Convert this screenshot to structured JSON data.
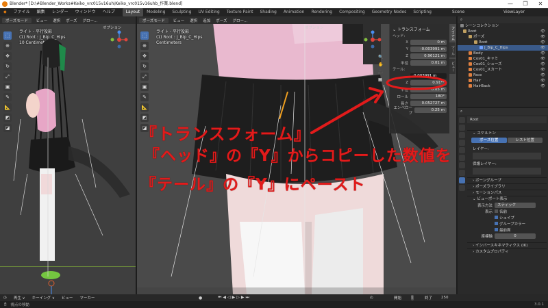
{
  "window": {
    "title": "Blender* [D:\\#Blender_Works#Keiko_vrc015v16uh\\Keiko_vrc015v16uhb_作業.blend]",
    "min": "—",
    "max": "❐",
    "close": "✕"
  },
  "menu": [
    "ファイル",
    "編集",
    "レンダー",
    "ウィンドウ",
    "ヘルプ"
  ],
  "tabs": [
    "Layout",
    "Modeling",
    "Sculpting",
    "UV Editing",
    "Texture Paint",
    "Shading",
    "Animation",
    "Rendering",
    "Compositing",
    "Geometry Nodes",
    "Scripting"
  ],
  "scene": {
    "label": "Scene",
    "viewlayer": "ViewLayer"
  },
  "left_view": {
    "mode": "ポーズモード",
    "menus": [
      "ビュー",
      "選択",
      "ポーズ"
    ],
    "orientation": "グロー...",
    "options": "オプション",
    "info": [
      "ライト - 平行投影",
      "(1) Root : J_Bip_C_Hips",
      "10 Centimeters"
    ]
  },
  "mid_view": {
    "mode": "ポーズモード",
    "menus": [
      "ビュー",
      "選択",
      "追加",
      "ポーズ"
    ],
    "orientation": "グロー...",
    "options": "オプション",
    "info": [
      "ライト - 平行投影",
      "(1) Root : J_Bip_C_Hips",
      "Centimeters"
    ]
  },
  "npanel": {
    "section": "トランスフォーム",
    "head_label": "ヘッド:",
    "head": [
      {
        "label": "X",
        "value": "0 m"
      },
      {
        "label": "Y",
        "value": "-0.003991 m"
      },
      {
        "label": "Z",
        "value": "0.96121 m"
      }
    ],
    "radius1": {
      "label": "半径",
      "value": "0.01 m"
    },
    "tail_label": "テール:",
    "tail_input": "-0.003991 m",
    "tail": [
      {
        "label": "Z",
        "value": "0.91**"
      }
    ],
    "more": [
      {
        "label": "半径",
        "value": "0.05 m"
      },
      {
        "label": "ロール",
        "value": "180°"
      },
      {
        "label": "長さ",
        "value": "0.052727 m"
      },
      {
        "label": "エンベロープ",
        "value": "0.25 m"
      }
    ],
    "vtabs": [
      "アイテム",
      "ツール",
      "ビュー"
    ]
  },
  "outliner": {
    "title": "シーンコレクション",
    "rows": [
      {
        "label": "Root",
        "indent": 0,
        "color": "#c0a060"
      },
      {
        "label": "ポーズ",
        "indent": 1,
        "color": "#c0a060"
      },
      {
        "label": "Root",
        "indent": 2,
        "color": "#c0a060"
      },
      {
        "label": "J_Bip_C_Hips",
        "indent": 3,
        "color": "#6fa0ff",
        "sel": true
      },
      {
        "label": "Body",
        "indent": 1,
        "color": "#e08040"
      },
      {
        "label": "Cos01_キャミ",
        "indent": 1,
        "color": "#e08040"
      },
      {
        "label": "Cos01_シューズ",
        "indent": 1,
        "color": "#e08040"
      },
      {
        "label": "Cos01_スカート",
        "indent": 1,
        "color": "#e08040"
      },
      {
        "label": "Face",
        "indent": 1,
        "color": "#e08040"
      },
      {
        "label": "Hair",
        "indent": 1,
        "color": "#e08040"
      },
      {
        "label": "HairBack",
        "indent": 1,
        "color": "#e08040"
      }
    ]
  },
  "properties": {
    "object": "Root",
    "skeleton": "スケルトン",
    "pose_position": "ポーズ位置",
    "rest_position": "レスト位置",
    "layers": "レイヤー:",
    "protected_layers": "保護レイヤー:",
    "sections": [
      "ボーングループ",
      "ポーズライブラリ",
      "モーションパス",
      "ビューポート表示"
    ],
    "display_as_label": "表示方法",
    "display_as_value": "スティック",
    "show_label": "表示",
    "show_items": [
      "名前",
      "シェイプ",
      "グループカラー",
      "最前面"
    ],
    "axes_label": "座標軸",
    "axes_value": "0",
    "bottom_sections": [
      "インバースキネマティクス (IK)",
      "カスタムプロパティ"
    ]
  },
  "timeline": {
    "play": "再生 ∨",
    "keying": "キーイング ∨",
    "view": "ビュー",
    "marker": "マーカー",
    "start_label": "開始",
    "start": "1",
    "end_label": "終了",
    "end": "250"
  },
  "status": {
    "hint": "視点の移動",
    "version": "3.0.1"
  },
  "annotation": {
    "line1": "『トランスフォーム』",
    "line2": "『ヘッド』の『Y』からコピーした数値を",
    "line3": "『テール』の『Y』にペースト",
    "color": "#e21b1b"
  }
}
